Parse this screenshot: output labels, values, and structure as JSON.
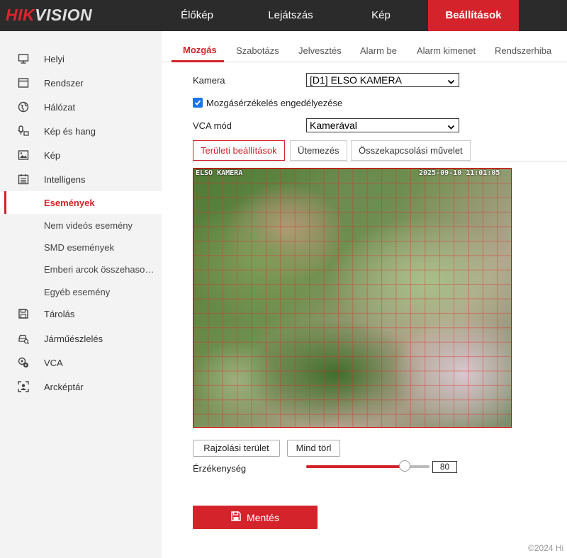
{
  "brand": {
    "logo_red": "HIK",
    "logo_rest": "VISION",
    "accent": "#d4232b"
  },
  "topnav": [
    {
      "label": "Élőkép"
    },
    {
      "label": "Lejátszás"
    },
    {
      "label": "Kép"
    },
    {
      "label": "Beállítások",
      "active": true
    }
  ],
  "sidebar": {
    "items": [
      {
        "label": "Helyi",
        "icon": "monitor-icon"
      },
      {
        "label": "Rendszer",
        "icon": "window-icon"
      },
      {
        "label": "Hálózat",
        "icon": "globe-icon"
      },
      {
        "label": "Kép és hang",
        "icon": "video-audio-icon"
      },
      {
        "label": "Kép",
        "icon": "image-icon"
      },
      {
        "label": "Intelligens",
        "icon": "calendar-icon"
      },
      {
        "label": "Események",
        "active": true
      },
      {
        "label": "Nem videós esemény"
      },
      {
        "label": "SMD események"
      },
      {
        "label": "Emberi arcok összehasonlítása"
      },
      {
        "label": "Egyéb esemény"
      },
      {
        "label": "Tárolás",
        "icon": "storage-icon"
      },
      {
        "label": "Járműészlelés",
        "icon": "vehicle-detect-icon"
      },
      {
        "label": "VCA",
        "icon": "vca-icon"
      },
      {
        "label": "Arcképtár",
        "icon": "face-library-icon"
      }
    ]
  },
  "tabs": [
    {
      "label": "Mozgás",
      "active": true
    },
    {
      "label": "Szabotázs"
    },
    {
      "label": "Jelvesztés"
    },
    {
      "label": "Alarm be"
    },
    {
      "label": "Alarm kimenet"
    },
    {
      "label": "Rendszerhiba"
    }
  ],
  "form": {
    "camera_label": "Kamera",
    "camera_value": "[D1] ELSO KAMERA",
    "enable_label": "Mozgásérzékelés engedélyezése",
    "enable_checked": true,
    "vca_label": "VCA mód",
    "vca_value": "Kamerával"
  },
  "subtabs": [
    {
      "label": "Területi beállítások",
      "active": true
    },
    {
      "label": "Ütemezés"
    },
    {
      "label": "Összekapcsolási művelet"
    }
  ],
  "video": {
    "osd_left": "ELSO KAMERA",
    "osd_right": "2025-09-10 11:01:05"
  },
  "buttons": {
    "draw": "Rajzolási terület",
    "clear": "Mind törl"
  },
  "sensitivity": {
    "label": "Érzékenység",
    "value": "80",
    "percent": 80
  },
  "save": {
    "label": "Mentés"
  },
  "footer": {
    "text": "©2024 Hi"
  }
}
